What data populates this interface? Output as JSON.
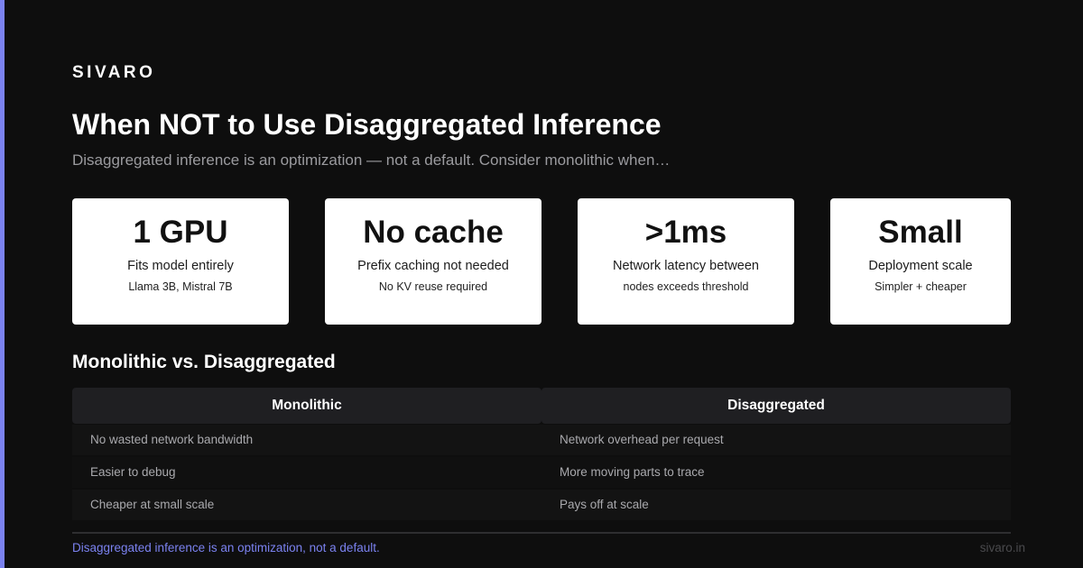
{
  "brand": "SIVARO",
  "title": "When NOT to Use Disaggregated Inference",
  "subtitle": "Disaggregated inference is an optimization — not a default. Consider monolithic when…",
  "cards": [
    {
      "value": "1 GPU",
      "label": "Fits model entirely",
      "note": "Llama 3B, Mistral 7B"
    },
    {
      "value": "No cache",
      "label": "Prefix caching not needed",
      "note": "No KV reuse required"
    },
    {
      "value": ">1ms",
      "label": "Network latency between",
      "note": "nodes exceeds threshold"
    },
    {
      "value": "Small",
      "label": "Deployment scale",
      "note": "Simpler + cheaper"
    }
  ],
  "comparison": {
    "heading": "Monolithic vs. Disaggregated",
    "columns": [
      {
        "header": "Monolithic",
        "rows": [
          "No wasted network bandwidth",
          "Easier to debug",
          "Cheaper at small scale"
        ]
      },
      {
        "header": "Disaggregated",
        "rows": [
          "Network overhead per request",
          "More moving parts to trace",
          "Pays off at scale"
        ]
      }
    ]
  },
  "footer": {
    "note": "Disaggregated inference is an optimization, not a default.",
    "domain": "sivaro.in"
  },
  "colors": {
    "accent": "#7b82f0",
    "background": "#0e0e0e",
    "card_background": "#ffffff"
  }
}
